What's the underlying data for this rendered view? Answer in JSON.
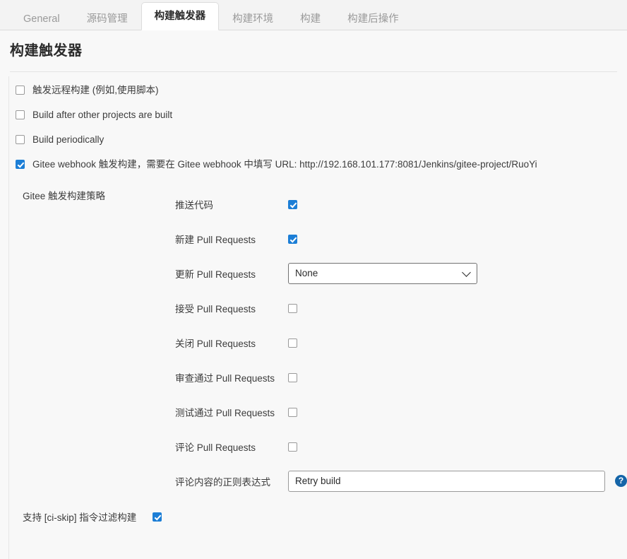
{
  "tabs": [
    {
      "label": "General",
      "active": false
    },
    {
      "label": "源码管理",
      "active": false
    },
    {
      "label": "构建触发器",
      "active": true
    },
    {
      "label": "构建环境",
      "active": false
    },
    {
      "label": "构建",
      "active": false
    },
    {
      "label": "构建后操作",
      "active": false
    }
  ],
  "page": {
    "title": "构建触发器"
  },
  "colors": {
    "accent_checkbox": "#1c7ed6",
    "help_icon": "#1565a8",
    "page_background": "#f8f8f8",
    "tabbar_background": "#f3f3f3"
  },
  "triggers": [
    {
      "label": "触发远程构建 (例如,使用脚本)",
      "checked": false
    },
    {
      "label": "Build after other projects are built",
      "checked": false
    },
    {
      "label": "Build periodically",
      "checked": false
    },
    {
      "label": "Gitee webhook 触发构建，需要在 Gitee webhook 中填写 URL: http://192.168.101.177:8081/Jenkins/gitee-project/RuoYi",
      "checked": true
    }
  ],
  "strategy": {
    "title": "Gitee 触发构建策略",
    "rows": [
      {
        "label": "推送代码",
        "type": "checkbox",
        "checked": true
      },
      {
        "label": "新建 Pull Requests",
        "type": "checkbox",
        "checked": true
      },
      {
        "label": "更新 Pull Requests",
        "type": "select",
        "value": "None"
      },
      {
        "label": "接受 Pull Requests",
        "type": "checkbox",
        "checked": false
      },
      {
        "label": "关闭 Pull Requests",
        "type": "checkbox",
        "checked": false
      },
      {
        "label": "审查通过 Pull Requests",
        "type": "checkbox",
        "checked": false
      },
      {
        "label": "测试通过 Pull Requests",
        "type": "checkbox",
        "checked": false
      },
      {
        "label": "评论 Pull Requests",
        "type": "checkbox",
        "checked": false
      },
      {
        "label": "评论内容的正则表达式",
        "type": "text",
        "value": "Retry build",
        "help": "?"
      }
    ]
  },
  "ci_skip": {
    "label": "支持 [ci-skip] 指令过滤构建",
    "checked": true
  }
}
